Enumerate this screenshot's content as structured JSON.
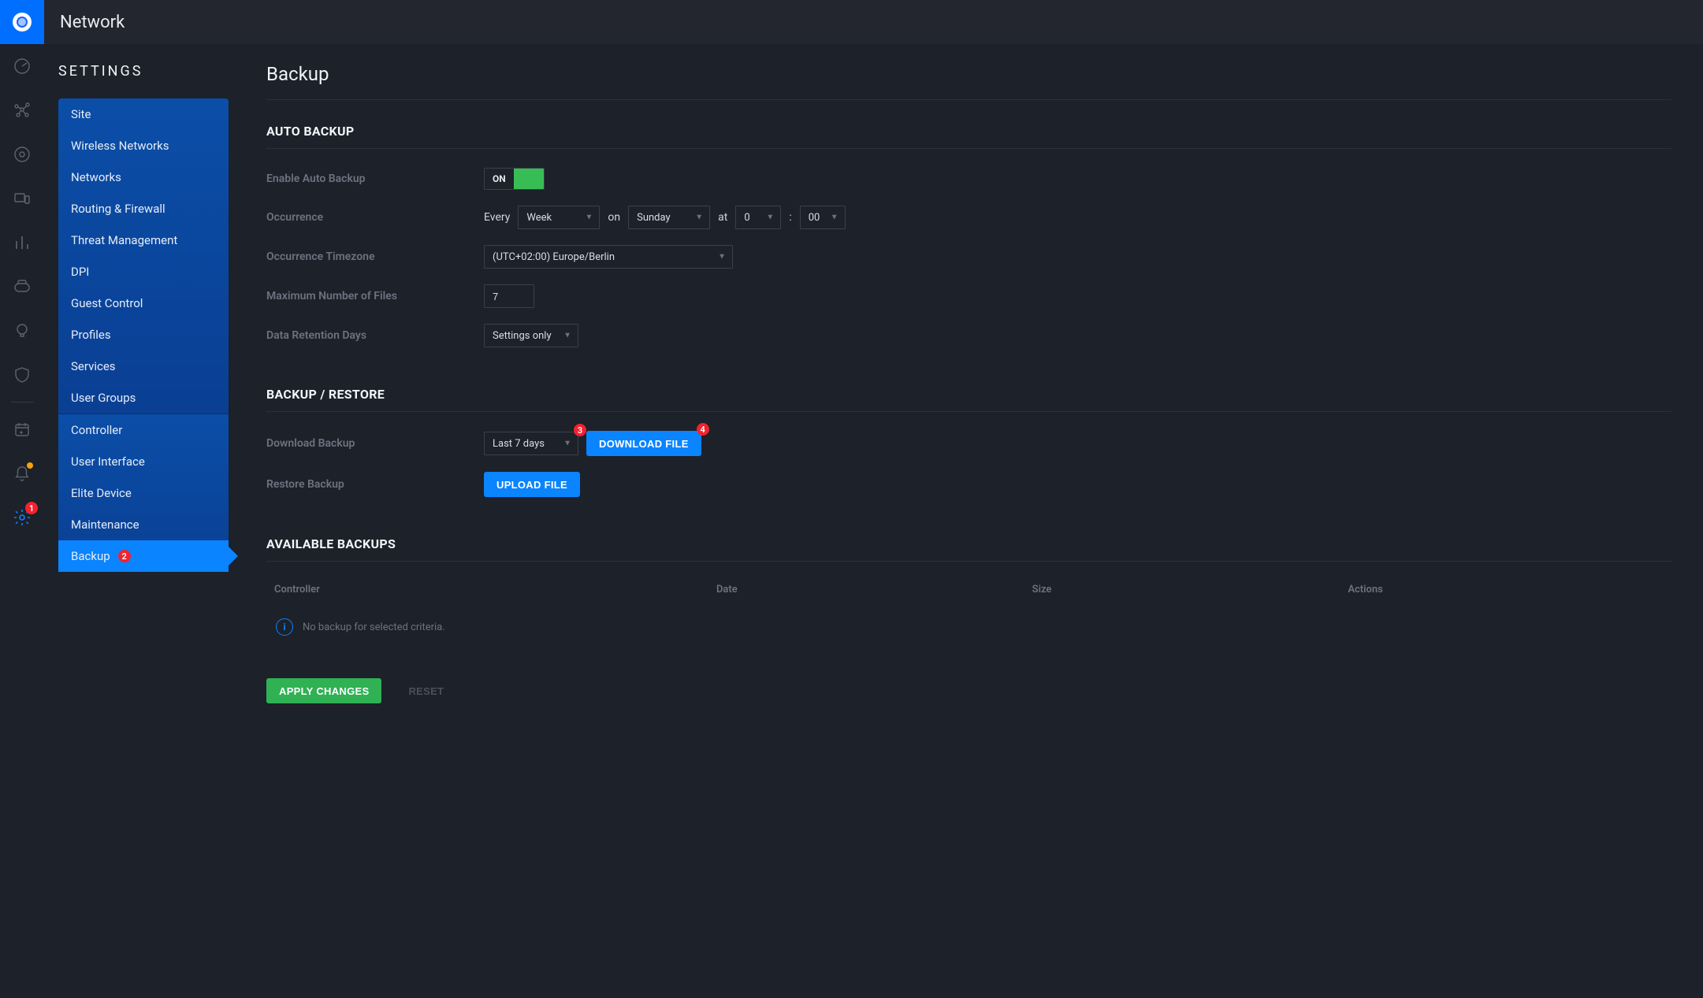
{
  "topbar": {
    "title": "Network"
  },
  "settings_nav": {
    "title": "SETTINGS",
    "group1": [
      {
        "label": "Site"
      },
      {
        "label": "Wireless Networks"
      },
      {
        "label": "Networks"
      },
      {
        "label": "Routing & Firewall"
      },
      {
        "label": "Threat Management"
      },
      {
        "label": "DPI"
      },
      {
        "label": "Guest Control"
      },
      {
        "label": "Profiles"
      },
      {
        "label": "Services"
      },
      {
        "label": "User Groups"
      }
    ],
    "group2": [
      {
        "label": "Controller"
      },
      {
        "label": "User Interface"
      },
      {
        "label": "Elite Device"
      },
      {
        "label": "Maintenance"
      },
      {
        "label": "Backup",
        "active": true,
        "badge": "2"
      }
    ]
  },
  "rail_badges": {
    "settings": "1"
  },
  "page": {
    "title": "Backup"
  },
  "auto_backup": {
    "heading": "AUTO BACKUP",
    "enable_label": "Enable Auto Backup",
    "toggle_state": "ON",
    "occurrence_label": "Occurrence",
    "occurrence_every": "Every",
    "occurrence_period": "Week",
    "occurrence_on": "on",
    "occurrence_day": "Sunday",
    "occurrence_at": "at",
    "occurrence_hour": "0",
    "occurrence_sep": ":",
    "occurrence_min": "00",
    "tz_label": "Occurrence Timezone",
    "tz_value": "(UTC+02:00) Europe/Berlin",
    "max_files_label": "Maximum Number of Files",
    "max_files_value": "7",
    "retention_label": "Data Retention Days",
    "retention_value": "Settings only"
  },
  "backup_restore": {
    "heading": "BACKUP / RESTORE",
    "download_label": "Download Backup",
    "download_range": "Last 7 days",
    "download_badge": "3",
    "download_btn": "DOWNLOAD FILE",
    "download_btn_badge": "4",
    "restore_label": "Restore Backup",
    "upload_btn": "UPLOAD FILE"
  },
  "available": {
    "heading": "AVAILABLE BACKUPS",
    "cols": {
      "controller": "Controller",
      "date": "Date",
      "size": "Size",
      "actions": "Actions"
    },
    "empty_msg": "No backup for selected criteria."
  },
  "actions": {
    "apply": "APPLY CHANGES",
    "reset": "RESET"
  },
  "icons": {
    "info": "i"
  }
}
